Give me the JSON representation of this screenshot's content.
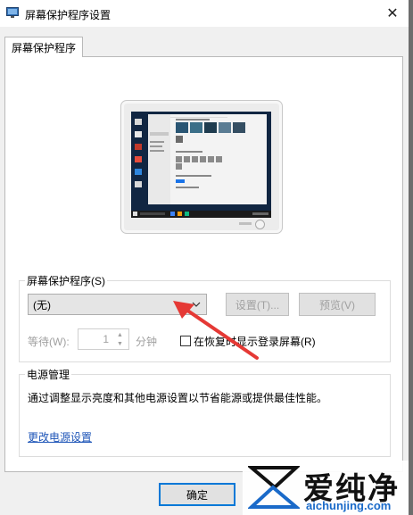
{
  "window": {
    "title": "屏幕保护程序设置",
    "close_glyph": "✕"
  },
  "tabs": [
    {
      "label": "屏幕保护程序"
    }
  ],
  "screensaver": {
    "group_label": "屏幕保护程序(S)",
    "selected": "(无)",
    "settings_label": "设置(T)...",
    "preview_label": "预览(V)",
    "wait_label": "等待(W):",
    "wait_value": "1",
    "minute_label": "分钟",
    "resume_label": "在恢复时显示登录屏幕(R)",
    "resume_checked": false
  },
  "power": {
    "group_label": "电源管理",
    "description": "通过调整显示亮度和其他电源设置以节省能源或提供最佳性能。",
    "link": "更改电源设置"
  },
  "footer": {
    "ok_label": "确定"
  },
  "watermark": {
    "brand": "爱纯净",
    "url": "aichunjing.com"
  },
  "colors": {
    "accent": "#0078d7",
    "link": "#1f56b8",
    "arrow": "#e53935"
  }
}
